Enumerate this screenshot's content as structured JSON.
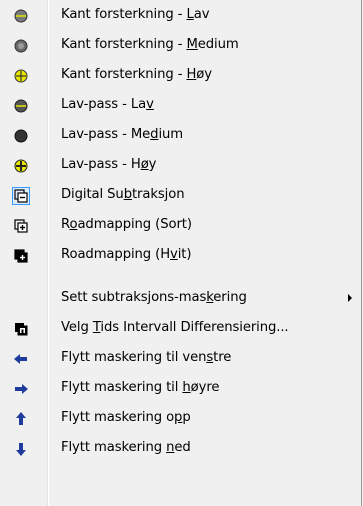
{
  "menu": {
    "items": [
      {
        "pre": "Kant forsterkning - ",
        "key": "L",
        "post": "av",
        "icon": "edge-enhance-low-icon"
      },
      {
        "pre": "Kant forsterkning - ",
        "key": "M",
        "post": "edium",
        "icon": "edge-enhance-medium-icon"
      },
      {
        "pre": "Kant forsterkning - ",
        "key": "H",
        "post": "øy",
        "icon": "edge-enhance-high-icon"
      },
      {
        "pre": "Lav-pass - La",
        "key": "v",
        "post": "",
        "icon": "low-pass-low-icon"
      },
      {
        "pre": "Lav-pass - Me",
        "key": "d",
        "post": "ium",
        "icon": "low-pass-medium-icon"
      },
      {
        "pre": "Lav-pass - H",
        "key": "ø",
        "post": "y",
        "icon": "low-pass-high-icon"
      },
      {
        "pre": "Digital Su",
        "key": "b",
        "post": "traksjon",
        "icon": "digital-subtraction-icon"
      },
      {
        "pre": "R",
        "key": "o",
        "post": "admapping (Sort)",
        "icon": "roadmapping-black-icon"
      },
      {
        "pre": "Roadmapping (H",
        "key": "v",
        "post": "it)",
        "icon": "roadmapping-white-icon"
      },
      {
        "pre": "Sett subtraksjons-mas",
        "key": "k",
        "post": "ering",
        "icon": ""
      },
      {
        "pre": "Velg ",
        "key": "T",
        "post": "ids Intervall Differensiering...",
        "icon": "time-interval-icon"
      },
      {
        "pre": "Flytt maskering til ven",
        "key": "s",
        "post": "tre",
        "icon": "arrow-left-icon"
      },
      {
        "pre": "Flytt maskering til ",
        "key": "h",
        "post": "øyre",
        "icon": "arrow-right-icon"
      },
      {
        "pre": "Flytt maskering o",
        "key": "p",
        "post": "p",
        "icon": "arrow-up-icon"
      },
      {
        "pre": "Flytt maskering ",
        "key": "n",
        "post": "ed",
        "icon": "arrow-down-icon"
      }
    ]
  }
}
